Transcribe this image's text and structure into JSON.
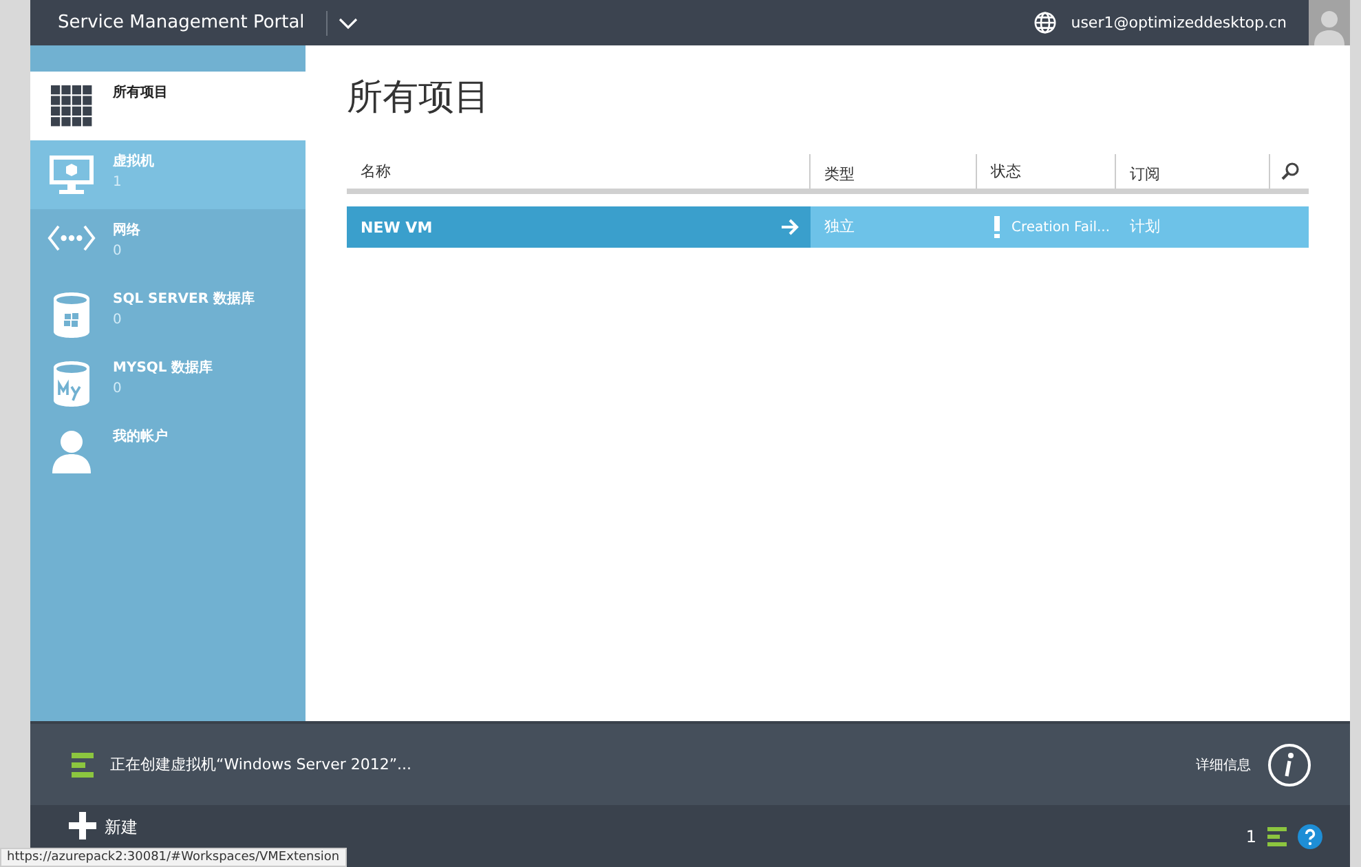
{
  "header": {
    "title": "Service Management Portal",
    "user": "user1@optimizeddesktop.cn"
  },
  "sidebar": {
    "items": [
      {
        "kind": "all",
        "label": "所有项目",
        "selected": true
      },
      {
        "kind": "vm",
        "label": "虚拟机",
        "count": "1",
        "selected": false,
        "highlighted": true
      },
      {
        "kind": "network",
        "label": "网络",
        "count": "0",
        "selected": false
      },
      {
        "kind": "sql",
        "label": "SQL SERVER 数据库",
        "count": "0",
        "selected": false
      },
      {
        "kind": "mysql",
        "label": "MYSQL 数据库",
        "count": "0",
        "selected": false
      },
      {
        "kind": "account",
        "label": "我的帐户",
        "selected": false
      }
    ]
  },
  "main": {
    "title": "所有项目",
    "table": {
      "columns": [
        "名称",
        "类型",
        "状态",
        "订阅"
      ],
      "rows": [
        {
          "name": "NEW VM",
          "type": "独立",
          "status": "Creation Fail...",
          "status_warning": true,
          "subscription": "计划",
          "selected": true
        }
      ]
    }
  },
  "notification": {
    "message": "正在创建虚拟机“Windows Server 2012”...",
    "details": "详细信息"
  },
  "command_bar": {
    "new": "新建",
    "count": "1"
  },
  "status_url": "https://azurepack2:30081/#Workspaces/VMExtension"
}
